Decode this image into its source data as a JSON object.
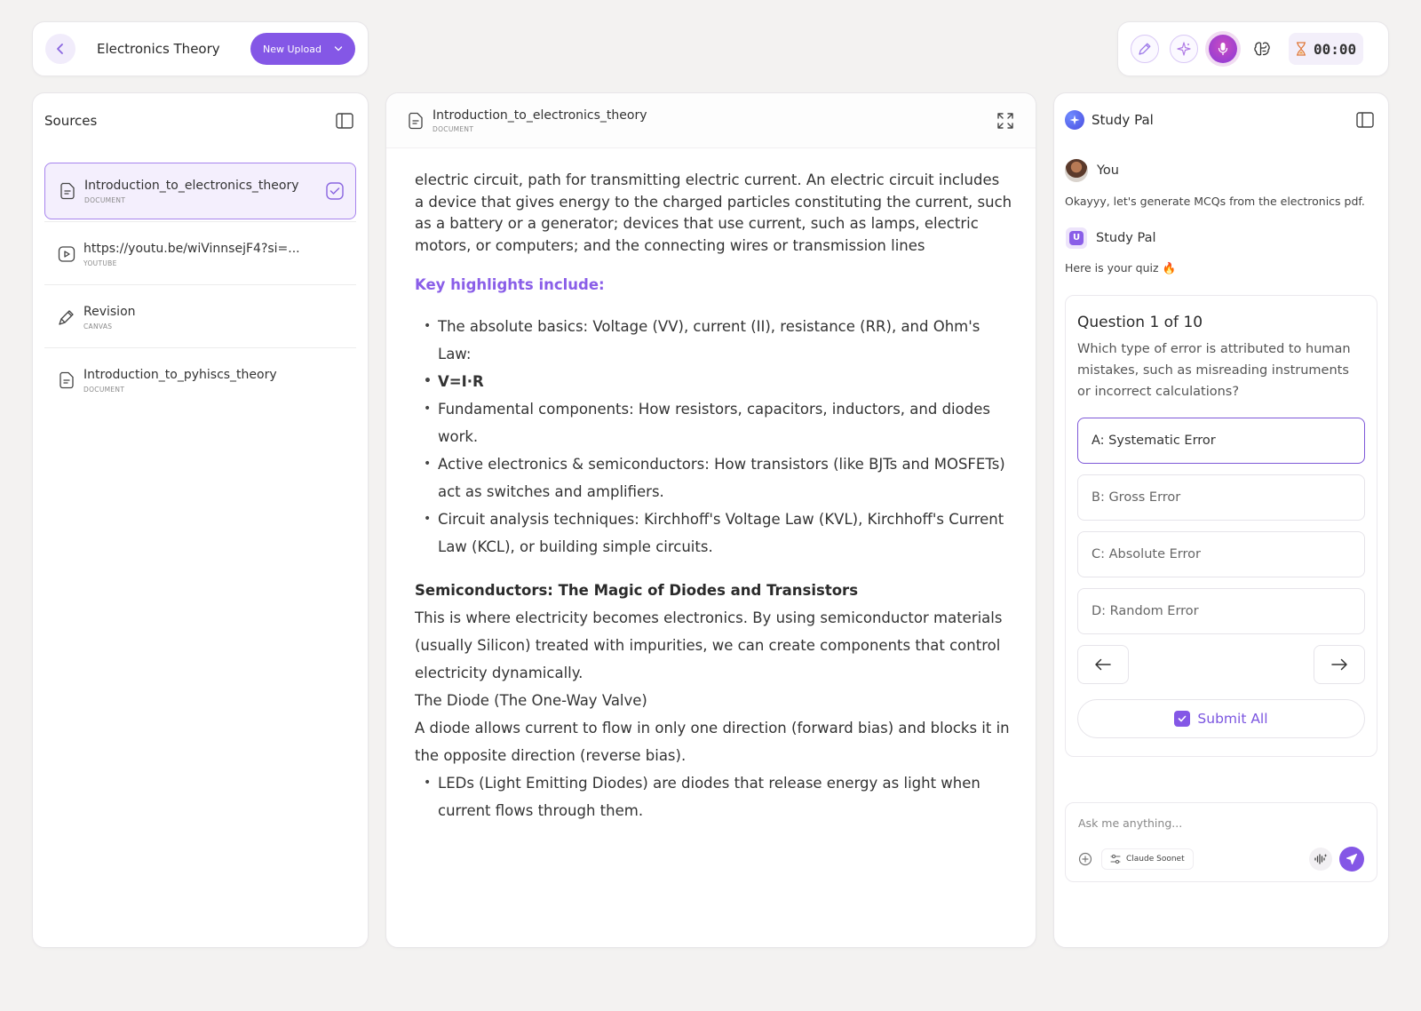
{
  "header": {
    "title": "Electronics Theory",
    "new_upload_label": "New Upload"
  },
  "toolbar": {
    "timer": "00:00",
    "icons": [
      "pen-icon",
      "sparkle-icon",
      "microphone-icon",
      "brain-icon",
      "hourglass-icon"
    ]
  },
  "sources": {
    "title": "Sources",
    "items": [
      {
        "name": "Introduction_to_electronics_theory",
        "type": "DOCUMENT",
        "icon": "document-icon",
        "active": true
      },
      {
        "name": "https://youtu.be/wiVinnsejF4?si=...",
        "type": "YOUTUBE",
        "icon": "youtube-icon",
        "active": false
      },
      {
        "name": "Revision",
        "type": "CANVAS",
        "icon": "pen-icon",
        "active": false
      },
      {
        "name": "Introduction_to_pyhiscs_theory",
        "type": "DOCUMENT",
        "icon": "document-icon",
        "active": false
      }
    ]
  },
  "document": {
    "name": "Introduction_to_electronics_theory",
    "type": "DOCUMENT",
    "intro": "electric circuit, path for transmitting electric current. An electric circuit includes a device that gives energy to the charged particles constituting the current, such as a battery or a generator; devices that use current, such as lamps, electric motors, or computers; and the connecting wires or transmission lines",
    "highlights_title": "Key highlights include:",
    "highlights": [
      "The absolute basics: Voltage (VV), current (II), resistance (RR), and Ohm's Law:",
      "V=I·R",
      "Fundamental components: How resistors, capacitors, inductors, and diodes work.",
      "Active electronics & semiconductors: How transistors (like BJTs and MOSFETs) act as switches and amplifiers.",
      "Circuit analysis techniques: Kirchhoff's Voltage Law (KVL), Kirchhoff's Current Law (KCL), or building simple circuits."
    ],
    "section_title": "Semiconductors: The Magic of Diodes and Transistors",
    "section_p1": "This is where electricity becomes electronics. By using semiconductor materials (usually Silicon) treated with impurities, we can create components that control electricity dynamically.",
    "section_p2": "The Diode (The One-Way Valve)",
    "section_p3": "A diode allows current to flow in only one direction (forward bias) and blocks it in the opposite direction (reverse bias).",
    "section_bullets": [
      "LEDs (Light Emitting Diodes) are diodes that release energy as light when current flows through them."
    ]
  },
  "studypal": {
    "title": "Study Pal",
    "user_name": "You",
    "user_message": "Okayyy, let's generate MCQs from the electronics pdf.",
    "bot_name": "Study Pal",
    "bot_message": "Here is your quiz 🔥",
    "quiz": {
      "title": "Question 1 of 10",
      "question": "Which type of error is attributed to human mistakes, such as misreading instruments or incorrect calculations?",
      "options": [
        "A: Systematic Error",
        "B: Gross Error",
        "C: Absolute Error",
        "D: Random Error"
      ],
      "selected_index": 0,
      "submit_label": "Submit All"
    },
    "composer": {
      "placeholder": "Ask me anything...",
      "model": "Claude Soonet"
    }
  },
  "colors": {
    "accent": "#8457e6",
    "accent_light": "#f4effd",
    "highlight_text": "#8a5ee8"
  }
}
